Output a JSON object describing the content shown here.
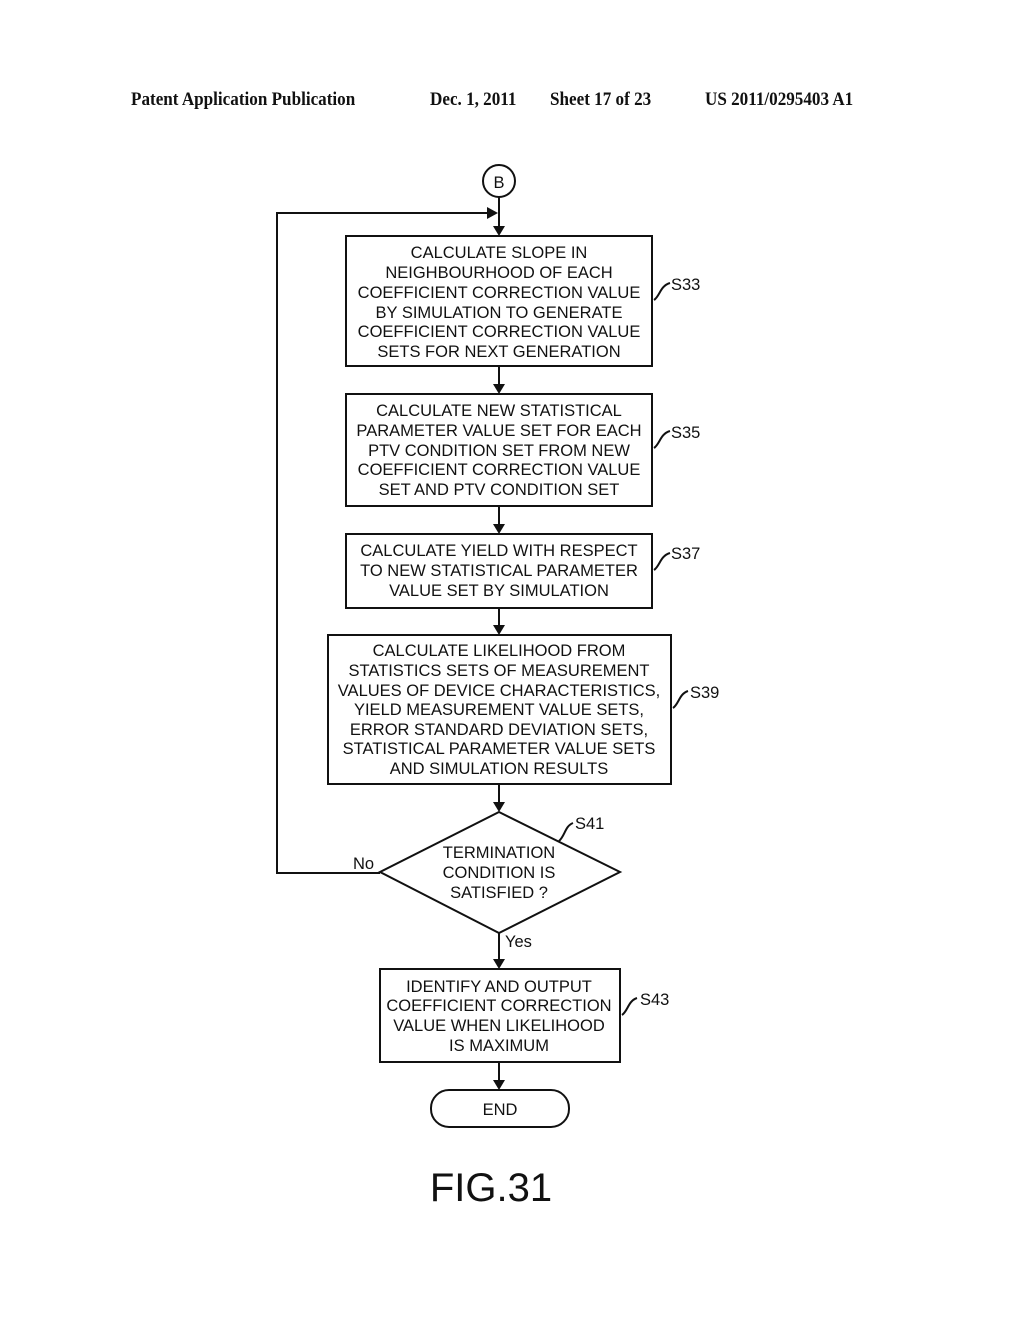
{
  "header": {
    "publication": "Patent Application Publication",
    "date": "Dec. 1, 2011",
    "sheet": "Sheet 17 of 23",
    "number": "US 2011/0295403 A1"
  },
  "connector": {
    "label": "B"
  },
  "steps": [
    {
      "id": "S33",
      "lines": [
        "CALCULATE SLOPE IN",
        "NEIGHBOURHOOD OF EACH",
        "COEFFICIENT CORRECTION VALUE",
        "BY SIMULATION TO GENERATE",
        "COEFFICIENT CORRECTION VALUE",
        "SETS FOR NEXT GENERATION"
      ]
    },
    {
      "id": "S35",
      "lines": [
        "CALCULATE NEW STATISTICAL",
        "PARAMETER VALUE SET FOR EACH",
        "PTV CONDITION SET FROM NEW",
        "COEFFICIENT CORRECTION VALUE",
        "SET AND PTV CONDITION SET"
      ]
    },
    {
      "id": "S37",
      "lines": [
        "CALCULATE YIELD WITH RESPECT",
        "TO NEW STATISTICAL PARAMETER",
        "VALUE SET BY SIMULATION"
      ]
    },
    {
      "id": "S39",
      "lines": [
        "CALCULATE LIKELIHOOD FROM",
        "STATISTICS SETS OF MEASUREMENT",
        "VALUES OF DEVICE CHARACTERISTICS,",
        "YIELD MEASUREMENT VALUE SETS,",
        "ERROR STANDARD DEVIATION SETS,",
        "STATISTICAL PARAMETER VALUE SETS",
        "AND SIMULATION RESULTS"
      ]
    }
  ],
  "decision": {
    "id": "S41",
    "lines": [
      "TERMINATION",
      "CONDITION IS",
      "SATISFIED ?"
    ],
    "no_label": "No",
    "yes_label": "Yes"
  },
  "final_step": {
    "id": "S43",
    "lines": [
      "IDENTIFY AND OUTPUT",
      "COEFFICIENT CORRECTION",
      "VALUE WHEN LIKELIHOOD",
      "IS MAXIMUM"
    ]
  },
  "terminator": {
    "label": "END"
  },
  "figure_label": "FIG.31"
}
